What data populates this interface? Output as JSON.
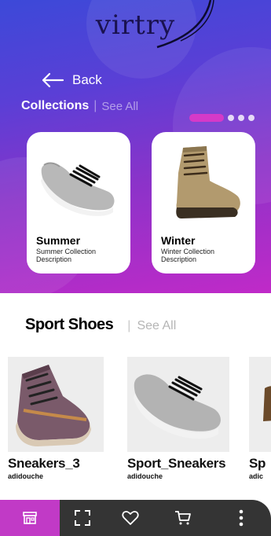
{
  "app": {
    "brand": "virtry"
  },
  "header": {
    "back_label": "Back"
  },
  "collections": {
    "title": "Collections",
    "separator": "|",
    "see_all": "See All",
    "pager": {
      "count": 4,
      "active_index": 0
    },
    "items": [
      {
        "name": "Summer",
        "description": "Summer Collection Description"
      },
      {
        "name": "Winter",
        "description": "Winter Collection Description"
      }
    ]
  },
  "sport": {
    "title": "Sport Shoes",
    "separator": "|",
    "see_all": "See All",
    "items": [
      {
        "name": "Sneakers_3",
        "brand": "adidouche"
      },
      {
        "name": "Sport_Sneakers",
        "brand": "adidouche"
      },
      {
        "name": "Sp",
        "brand": "adic"
      }
    ]
  },
  "navbar": {
    "items": [
      "store-icon",
      "fullscreen-icon",
      "heart-icon",
      "cart-icon",
      "more-vertical-icon"
    ],
    "active": "store-icon"
  },
  "colors": {
    "accent": "#c13ac6",
    "navbar_bg": "#343434",
    "hero_start": "#3c49d8",
    "hero_end": "#c02ac8"
  }
}
